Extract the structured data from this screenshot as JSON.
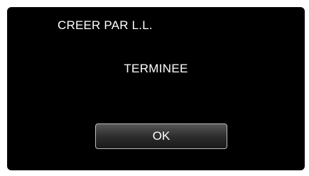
{
  "dialog": {
    "title": "CREER PAR L.L.",
    "message": "TERMINEE",
    "ok_label": "OK"
  },
  "colors": {
    "background": "#000000",
    "text": "#ffffff",
    "button_border": "#bdbdbd"
  }
}
